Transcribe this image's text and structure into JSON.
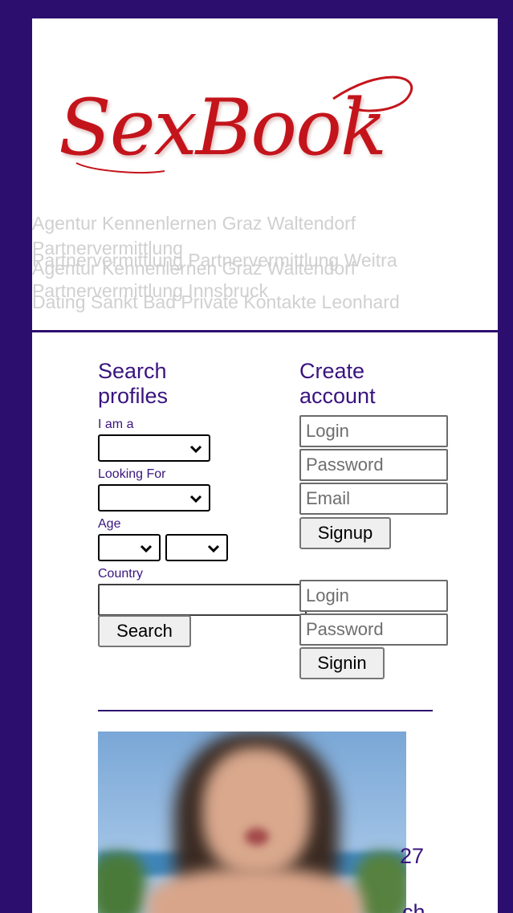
{
  "header": {
    "logo_text": "SexBook",
    "taglines": [
      "Agentur Kennenlernen Graz Waltendorf",
      "Partnervermittlung",
      "Partnervermittlung Partnervermittlung Weitra",
      "Agentur Kennenlernen Graz Waltendorf",
      "Partnervermittlung Innsbruck",
      "Dating Sankt Bad Private Kontakte Leonhard"
    ]
  },
  "search": {
    "title": "Search profiles",
    "i_am_label": "I am a",
    "looking_for_label": "Looking For",
    "age_label": "Age",
    "country_label": "Country",
    "search_button": "Search"
  },
  "signup": {
    "title": "Create account",
    "login_placeholder": "Login",
    "password_placeholder": "Password",
    "email_placeholder": "Email",
    "signup_button": "Signup"
  },
  "signin": {
    "login_placeholder": "Login",
    "password_placeholder": "Password",
    "signin_button": "Signin"
  },
  "profile": {
    "age": "27",
    "partial_text": "ch"
  },
  "colors": {
    "background": "#2c0e6e",
    "accent_text": "#3a147e",
    "logo": "#c4141b"
  }
}
